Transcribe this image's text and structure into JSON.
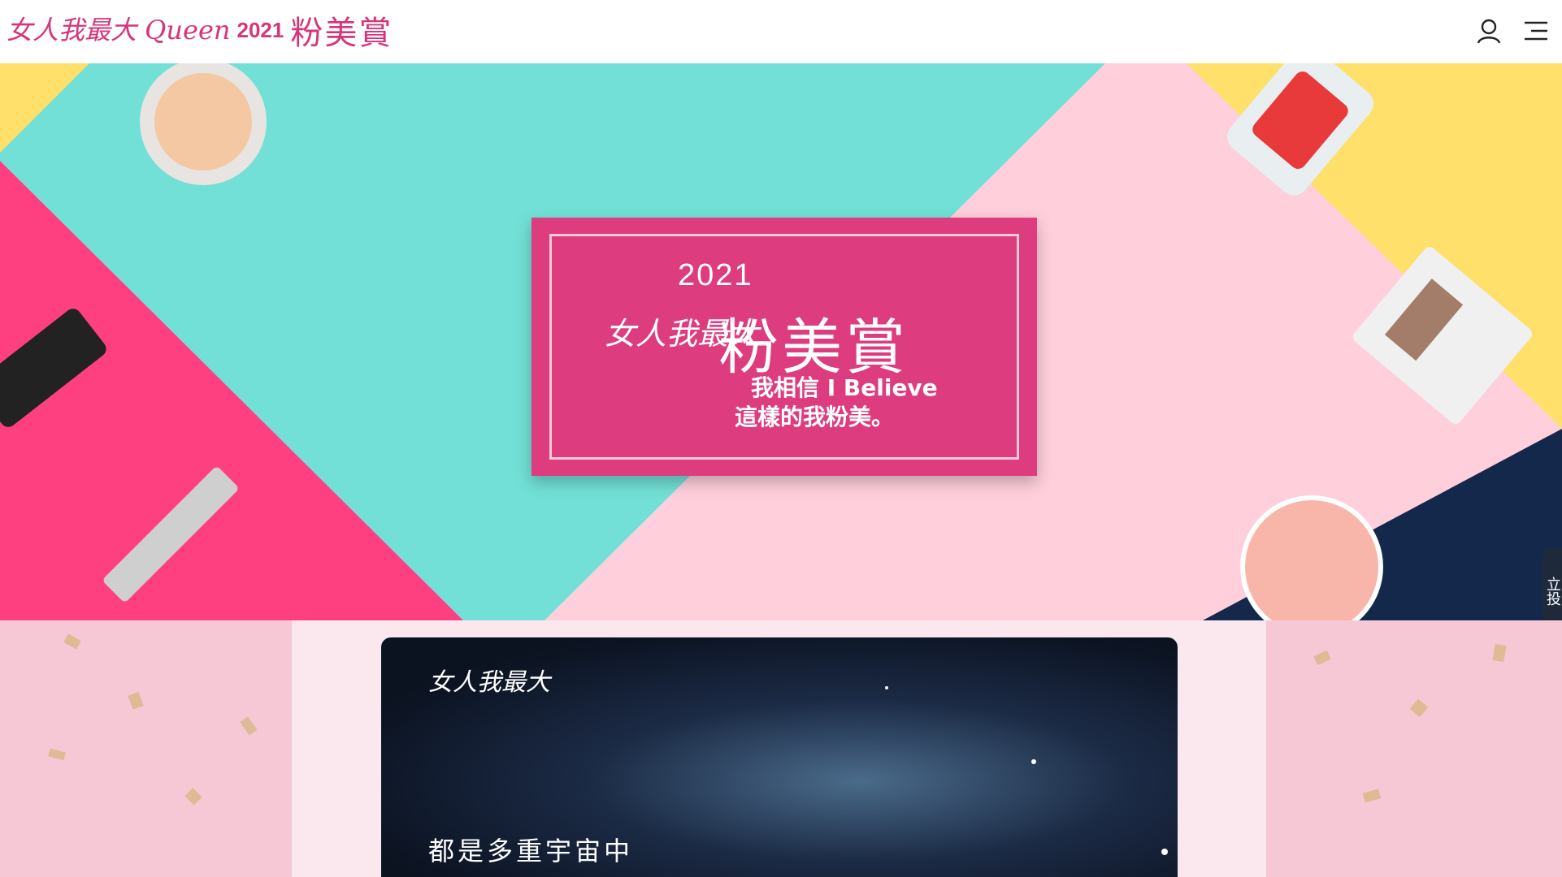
{
  "header": {
    "logo_script": "女人我最大 Queen",
    "logo_year": "2021",
    "logo_title": "粉美賞"
  },
  "hero": {
    "year": "2021",
    "brand": "女人我最大",
    "title": "粉美賞",
    "subtitle_line1": "我相信 I Believe",
    "subtitle_line2": "這樣的我粉美。"
  },
  "side_tab": {
    "label": "立投"
  },
  "video": {
    "logo": "女人我最大",
    "caption": "都是多重宇宙中"
  },
  "icons": [
    "user-icon",
    "menu-icon"
  ],
  "colors": {
    "brand_pink": "#d6357a",
    "teal": "#72e0d6",
    "hot_pink": "#ff4080",
    "light_pink": "#ffcfdc",
    "yellow": "#ffe06b",
    "navy": "#13284a"
  }
}
